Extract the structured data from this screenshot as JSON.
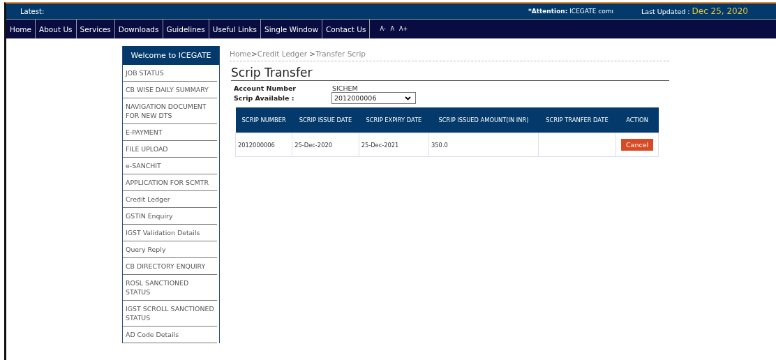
{
  "top_bar": {
    "latest_label": "Latest:",
    "attention_label": "*Attention:",
    "attention_text": "ICEGATE comı",
    "last_updated_label": "Last Updated :",
    "last_updated_value": "Dec 25, 2020"
  },
  "nav": {
    "items": [
      "Home",
      "About Us",
      "Services",
      "Downloads",
      "Guidelines",
      "Useful Links",
      "Single Window",
      "Contact Us"
    ],
    "font_sizes": [
      "A-",
      "A",
      "A+"
    ]
  },
  "sidebar": {
    "title": "Welcome to ICEGATE",
    "items": [
      "JOB STATUS",
      "CB WISE DAILY SUMMARY",
      "NAVIGATION DOCUMENT FOR NEW DTS",
      "E-PAYMENT",
      "FILE UPLOAD",
      "e-SANCHIT",
      "APPLICATION FOR SCMTR",
      "Credit Ledger",
      "GSTIN Enquiry",
      "IGST Validation Details",
      "Query Reply",
      "CB DIRECTORY ENQUIRY",
      "ROSL SANCTIONED STATUS",
      "IGST SCROLL SANCTIONED STATUS",
      "AD Code Details"
    ]
  },
  "breadcrumb": {
    "separator": ">",
    "items": [
      "Home",
      "Credit Ledger ",
      "Transfer Scrip"
    ]
  },
  "page_title": "Scrip Transfer",
  "form": {
    "account_label": "Account Number",
    "account_value": "SICHEM",
    "scrip_label": "Scrip Available :",
    "scrip_value": "2012000006"
  },
  "table": {
    "columns": [
      "SCRIP NUMBER",
      "SCRIP ISSUE DATE",
      "SCRIP EXPIRY DATE",
      "SCRIP ISSUED AMOUNT(IN INR)",
      "SCRIP TRANFER DATE",
      "ACTION"
    ],
    "rows": [
      {
        "cells": [
          "2012000006",
          "25-Dec-2020",
          "25-Dec-2021",
          "350.0",
          ""
        ],
        "action": "Cancel"
      }
    ]
  }
}
